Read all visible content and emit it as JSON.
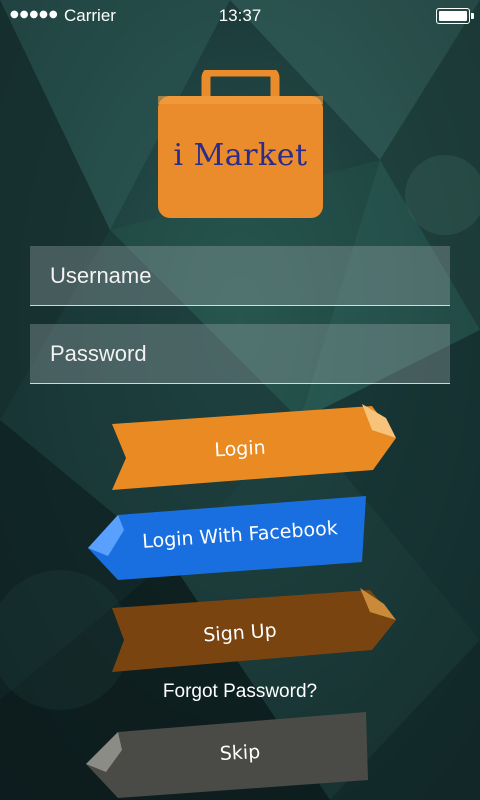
{
  "status_bar": {
    "signal": "●●●●●",
    "carrier": "Carrier",
    "time": "13:37"
  },
  "logo": {
    "text": "i Market"
  },
  "login_form": {
    "username_placeholder": "Username",
    "password_placeholder": "Password"
  },
  "buttons": {
    "login": "Login",
    "facebook": "Login With Facebook",
    "signup": "Sign Up",
    "forgot": "Forgot Password?",
    "skip": "Skip"
  },
  "colors": {
    "login": "#e98a22",
    "facebook": "#1a6fe0",
    "signup": "#7a4411",
    "skip": "#4a4a46",
    "logo_bag": "#ea8c2b"
  }
}
